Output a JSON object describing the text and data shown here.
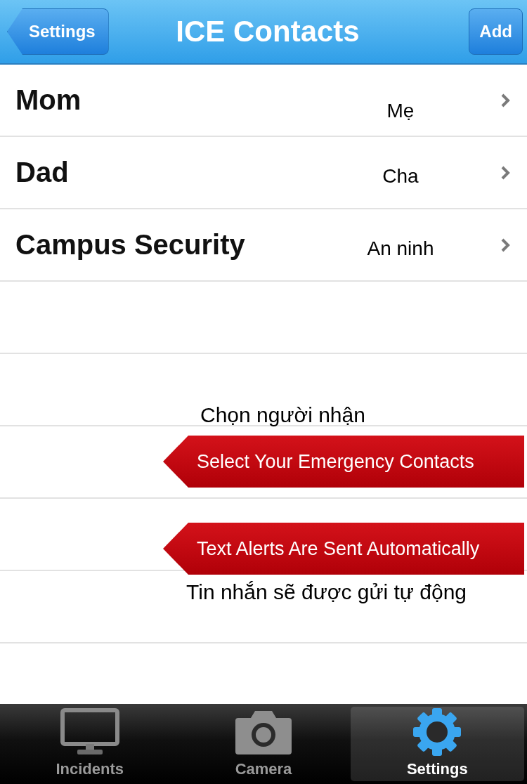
{
  "nav_bar": {
    "back_button": "Settings",
    "title": "ICE Contacts",
    "add_button": "Add"
  },
  "contacts": [
    {
      "name": "Mom",
      "note": "Mẹ"
    },
    {
      "name": "Dad",
      "note": "Cha"
    },
    {
      "name": "Campus Security",
      "note": "An ninh"
    }
  ],
  "annotations": [
    {
      "kind": "caption",
      "text": "Chọn người nhận"
    },
    {
      "kind": "banner",
      "text": "Select Your Emergency Contacts"
    },
    {
      "kind": "banner",
      "text": "Text Alerts Are Sent Automatically"
    },
    {
      "kind": "caption",
      "text": "Tin nhắn sẽ được gửi tự động"
    }
  ],
  "tabs": [
    {
      "kind": "monitor",
      "label": "Incidents",
      "selected": false
    },
    {
      "kind": "camera",
      "label": "Camera",
      "selected": false
    },
    {
      "kind": "gear",
      "label": "Settings",
      "selected": true
    }
  ]
}
